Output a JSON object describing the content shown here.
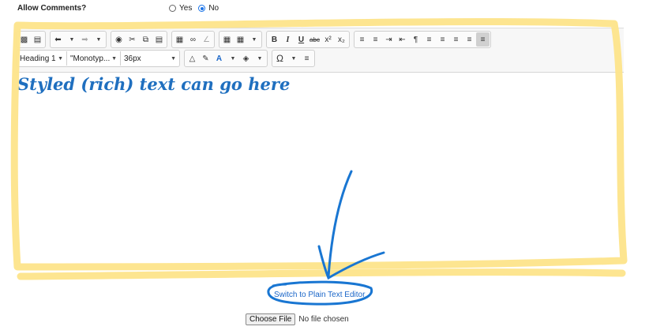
{
  "allow_comments": {
    "label": "Allow Comments?",
    "options": [
      {
        "label": "Yes",
        "selected": false
      },
      {
        "label": "No",
        "selected": true
      }
    ]
  },
  "toolbar": {
    "row1_icons": [
      [
        "image-icon",
        "document-icon"
      ],
      [
        "undo-icon",
        "undo-menu-caret-icon",
        "redo-icon",
        "redo-menu-caret-icon"
      ],
      [
        "find-icon",
        "cut-icon",
        "copy-icon",
        "paste-icon"
      ],
      [
        "insert-image-icon",
        "link-icon",
        "unlink-icon"
      ],
      [
        "table-icon",
        "table-menu-icon",
        "table-menu-caret-icon"
      ],
      [
        "bold-icon",
        "italic-icon",
        "underline-icon",
        "strikethrough-icon",
        "superscript-icon",
        "subscript-icon"
      ],
      [
        "bullet-list-icon",
        "numbered-list-icon",
        "indent-icon",
        "outdent-icon",
        "paragraph-icon",
        "align-left-icon",
        "align-center-icon",
        "align-right-icon",
        "justify-icon",
        "clear-formatting-icon"
      ]
    ],
    "format_select": "Heading 1",
    "font_select": "\"Monotyp...",
    "size_select": "36px",
    "row2_icons": [
      "highlight-icon",
      "format-painter-icon",
      "text-color-icon",
      "text-color-caret-icon",
      "fill-color-icon",
      "fill-color-caret-icon",
      "special-char-icon",
      "special-char-caret-icon",
      "line-height-icon"
    ]
  },
  "editor_content": "Styled (rich) text can go here",
  "switch_link": "Switch to Plain Text Editor",
  "file_input": {
    "button_label": "Choose File",
    "status": "No file chosen"
  },
  "colors": {
    "highlight": "#fde48a",
    "annotation_blue": "#1976d2",
    "rich_text": "#1f6fbf"
  }
}
